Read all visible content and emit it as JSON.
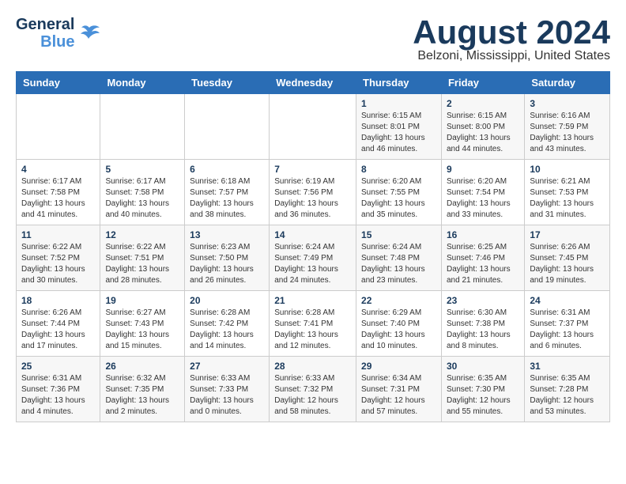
{
  "logo": {
    "line1": "General",
    "line2": "Blue"
  },
  "title": "August 2024",
  "location": "Belzoni, Mississippi, United States",
  "days_header": [
    "Sunday",
    "Monday",
    "Tuesday",
    "Wednesday",
    "Thursday",
    "Friday",
    "Saturday"
  ],
  "weeks": [
    [
      {
        "num": "",
        "info": ""
      },
      {
        "num": "",
        "info": ""
      },
      {
        "num": "",
        "info": ""
      },
      {
        "num": "",
        "info": ""
      },
      {
        "num": "1",
        "info": "Sunrise: 6:15 AM\nSunset: 8:01 PM\nDaylight: 13 hours\nand 46 minutes."
      },
      {
        "num": "2",
        "info": "Sunrise: 6:15 AM\nSunset: 8:00 PM\nDaylight: 13 hours\nand 44 minutes."
      },
      {
        "num": "3",
        "info": "Sunrise: 6:16 AM\nSunset: 7:59 PM\nDaylight: 13 hours\nand 43 minutes."
      }
    ],
    [
      {
        "num": "4",
        "info": "Sunrise: 6:17 AM\nSunset: 7:58 PM\nDaylight: 13 hours\nand 41 minutes."
      },
      {
        "num": "5",
        "info": "Sunrise: 6:17 AM\nSunset: 7:58 PM\nDaylight: 13 hours\nand 40 minutes."
      },
      {
        "num": "6",
        "info": "Sunrise: 6:18 AM\nSunset: 7:57 PM\nDaylight: 13 hours\nand 38 minutes."
      },
      {
        "num": "7",
        "info": "Sunrise: 6:19 AM\nSunset: 7:56 PM\nDaylight: 13 hours\nand 36 minutes."
      },
      {
        "num": "8",
        "info": "Sunrise: 6:20 AM\nSunset: 7:55 PM\nDaylight: 13 hours\nand 35 minutes."
      },
      {
        "num": "9",
        "info": "Sunrise: 6:20 AM\nSunset: 7:54 PM\nDaylight: 13 hours\nand 33 minutes."
      },
      {
        "num": "10",
        "info": "Sunrise: 6:21 AM\nSunset: 7:53 PM\nDaylight: 13 hours\nand 31 minutes."
      }
    ],
    [
      {
        "num": "11",
        "info": "Sunrise: 6:22 AM\nSunset: 7:52 PM\nDaylight: 13 hours\nand 30 minutes."
      },
      {
        "num": "12",
        "info": "Sunrise: 6:22 AM\nSunset: 7:51 PM\nDaylight: 13 hours\nand 28 minutes."
      },
      {
        "num": "13",
        "info": "Sunrise: 6:23 AM\nSunset: 7:50 PM\nDaylight: 13 hours\nand 26 minutes."
      },
      {
        "num": "14",
        "info": "Sunrise: 6:24 AM\nSunset: 7:49 PM\nDaylight: 13 hours\nand 24 minutes."
      },
      {
        "num": "15",
        "info": "Sunrise: 6:24 AM\nSunset: 7:48 PM\nDaylight: 13 hours\nand 23 minutes."
      },
      {
        "num": "16",
        "info": "Sunrise: 6:25 AM\nSunset: 7:46 PM\nDaylight: 13 hours\nand 21 minutes."
      },
      {
        "num": "17",
        "info": "Sunrise: 6:26 AM\nSunset: 7:45 PM\nDaylight: 13 hours\nand 19 minutes."
      }
    ],
    [
      {
        "num": "18",
        "info": "Sunrise: 6:26 AM\nSunset: 7:44 PM\nDaylight: 13 hours\nand 17 minutes."
      },
      {
        "num": "19",
        "info": "Sunrise: 6:27 AM\nSunset: 7:43 PM\nDaylight: 13 hours\nand 15 minutes."
      },
      {
        "num": "20",
        "info": "Sunrise: 6:28 AM\nSunset: 7:42 PM\nDaylight: 13 hours\nand 14 minutes."
      },
      {
        "num": "21",
        "info": "Sunrise: 6:28 AM\nSunset: 7:41 PM\nDaylight: 13 hours\nand 12 minutes."
      },
      {
        "num": "22",
        "info": "Sunrise: 6:29 AM\nSunset: 7:40 PM\nDaylight: 13 hours\nand 10 minutes."
      },
      {
        "num": "23",
        "info": "Sunrise: 6:30 AM\nSunset: 7:38 PM\nDaylight: 13 hours\nand 8 minutes."
      },
      {
        "num": "24",
        "info": "Sunrise: 6:31 AM\nSunset: 7:37 PM\nDaylight: 13 hours\nand 6 minutes."
      }
    ],
    [
      {
        "num": "25",
        "info": "Sunrise: 6:31 AM\nSunset: 7:36 PM\nDaylight: 13 hours\nand 4 minutes."
      },
      {
        "num": "26",
        "info": "Sunrise: 6:32 AM\nSunset: 7:35 PM\nDaylight: 13 hours\nand 2 minutes."
      },
      {
        "num": "27",
        "info": "Sunrise: 6:33 AM\nSunset: 7:33 PM\nDaylight: 13 hours\nand 0 minutes."
      },
      {
        "num": "28",
        "info": "Sunrise: 6:33 AM\nSunset: 7:32 PM\nDaylight: 12 hours\nand 58 minutes."
      },
      {
        "num": "29",
        "info": "Sunrise: 6:34 AM\nSunset: 7:31 PM\nDaylight: 12 hours\nand 57 minutes."
      },
      {
        "num": "30",
        "info": "Sunrise: 6:35 AM\nSunset: 7:30 PM\nDaylight: 12 hours\nand 55 minutes."
      },
      {
        "num": "31",
        "info": "Sunrise: 6:35 AM\nSunset: 7:28 PM\nDaylight: 12 hours\nand 53 minutes."
      }
    ]
  ]
}
